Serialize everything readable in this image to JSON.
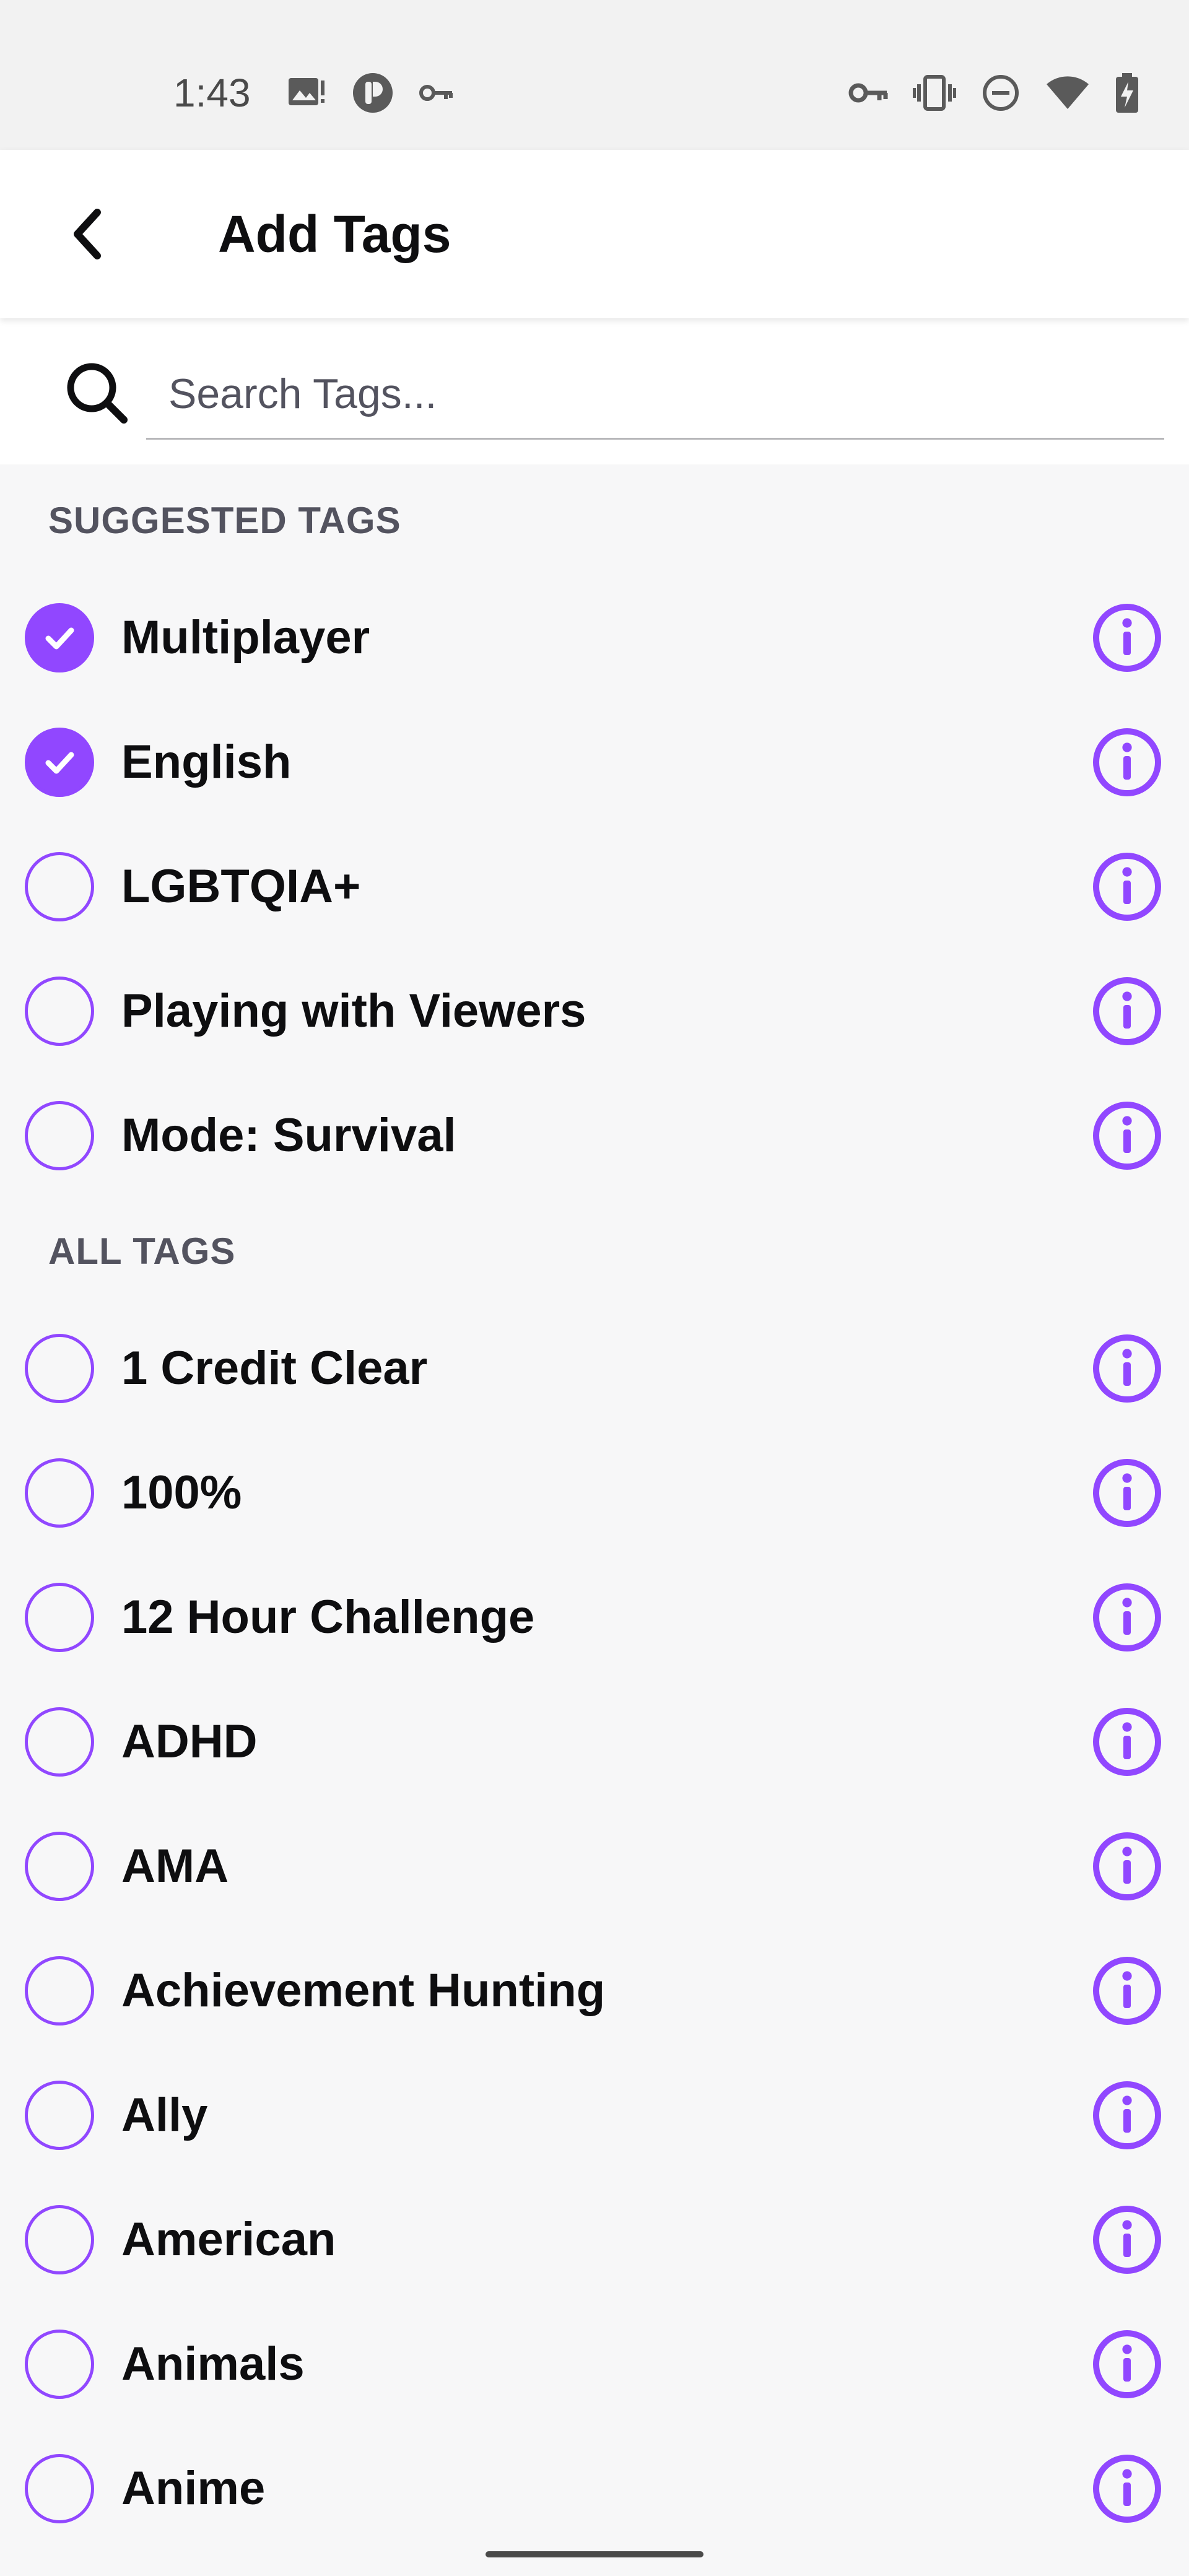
{
  "status_bar": {
    "time": "1:43",
    "left_icons": [
      "gallery-icon",
      "app-badge-icon",
      "vpn-key-icon"
    ],
    "right_icons": [
      "vpn-key-icon",
      "vibrate-icon",
      "do-not-disturb-icon",
      "wifi-icon",
      "battery-charging-icon"
    ]
  },
  "app_bar": {
    "back_icon": "chevron-left-icon",
    "title": "Add Tags"
  },
  "search": {
    "icon": "search-icon",
    "placeholder": "Search Tags...",
    "value": ""
  },
  "sections": {
    "suggested": {
      "header": "SUGGESTED TAGS",
      "tags": [
        {
          "label": "Multiplayer",
          "checked": true
        },
        {
          "label": "English",
          "checked": true
        },
        {
          "label": "LGBTQIA+",
          "checked": false
        },
        {
          "label": "Playing with Viewers",
          "checked": false
        },
        {
          "label": "Mode: Survival",
          "checked": false
        }
      ]
    },
    "all": {
      "header": "ALL TAGS",
      "tags": [
        {
          "label": "1 Credit Clear",
          "checked": false
        },
        {
          "label": "100%",
          "checked": false
        },
        {
          "label": "12 Hour Challenge",
          "checked": false
        },
        {
          "label": "ADHD",
          "checked": false
        },
        {
          "label": "AMA",
          "checked": false
        },
        {
          "label": "Achievement Hunting",
          "checked": false
        },
        {
          "label": "Ally",
          "checked": false
        },
        {
          "label": "American",
          "checked": false
        },
        {
          "label": "Animals",
          "checked": false
        },
        {
          "label": "Anime",
          "checked": false
        }
      ]
    }
  },
  "colors": {
    "accent": "#9147ff",
    "text": "#0e0e10",
    "secondary_text": "#53535f",
    "background": "#f7f7f8"
  },
  "icons": {
    "checkbox_checked": "check-icon",
    "info": "info-icon"
  }
}
